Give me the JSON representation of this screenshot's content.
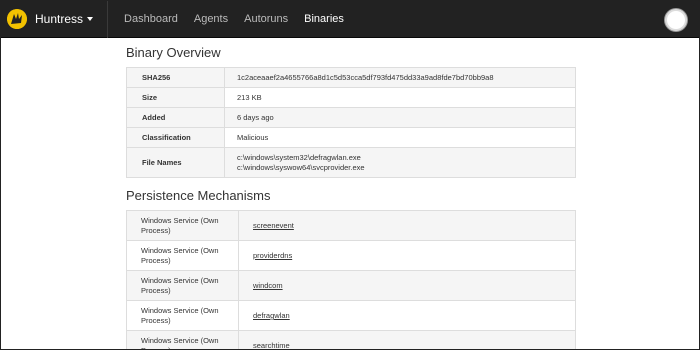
{
  "navbar": {
    "brand_label": "Huntress",
    "links": [
      "Dashboard",
      "Agents",
      "Autoruns",
      "Binaries"
    ],
    "active_link": "Binaries"
  },
  "overview": {
    "title": "Binary Overview",
    "rows": [
      {
        "key": "SHA256",
        "value": "1c2aceaaef2a4655766a8d1c5d53cca5df793fd475dd33a9ad8fde7bd70bb9a8"
      },
      {
        "key": "Size",
        "value": "213 KB"
      },
      {
        "key": "Added",
        "value": "6 days ago"
      },
      {
        "key": "Classification",
        "value": "Malicious"
      }
    ],
    "file_names_label": "File Names",
    "file_names": [
      "c:\\windows\\system32\\defragwlan.exe",
      "c:\\windows\\syswow64\\svcprovider.exe"
    ]
  },
  "persistence": {
    "title": "Persistence Mechanisms",
    "rows": [
      {
        "type": "Windows Service (Own Process)",
        "name": "screenevent"
      },
      {
        "type": "Windows Service (Own Process)",
        "name": "providerdns"
      },
      {
        "type": "Windows Service (Own Process)",
        "name": "windcom"
      },
      {
        "type": "Windows Service (Own Process)",
        "name": "defragwlan"
      },
      {
        "type": "Windows Service (Own Process)",
        "name": "searchtime"
      }
    ]
  },
  "icons": {
    "brand": "huntress-logo-icon",
    "user": "user-avatar-icon"
  },
  "colors": {
    "navbar_bg": "#222222",
    "logo_yellow": "#f2c100",
    "stripe": "#f5f5f5"
  }
}
